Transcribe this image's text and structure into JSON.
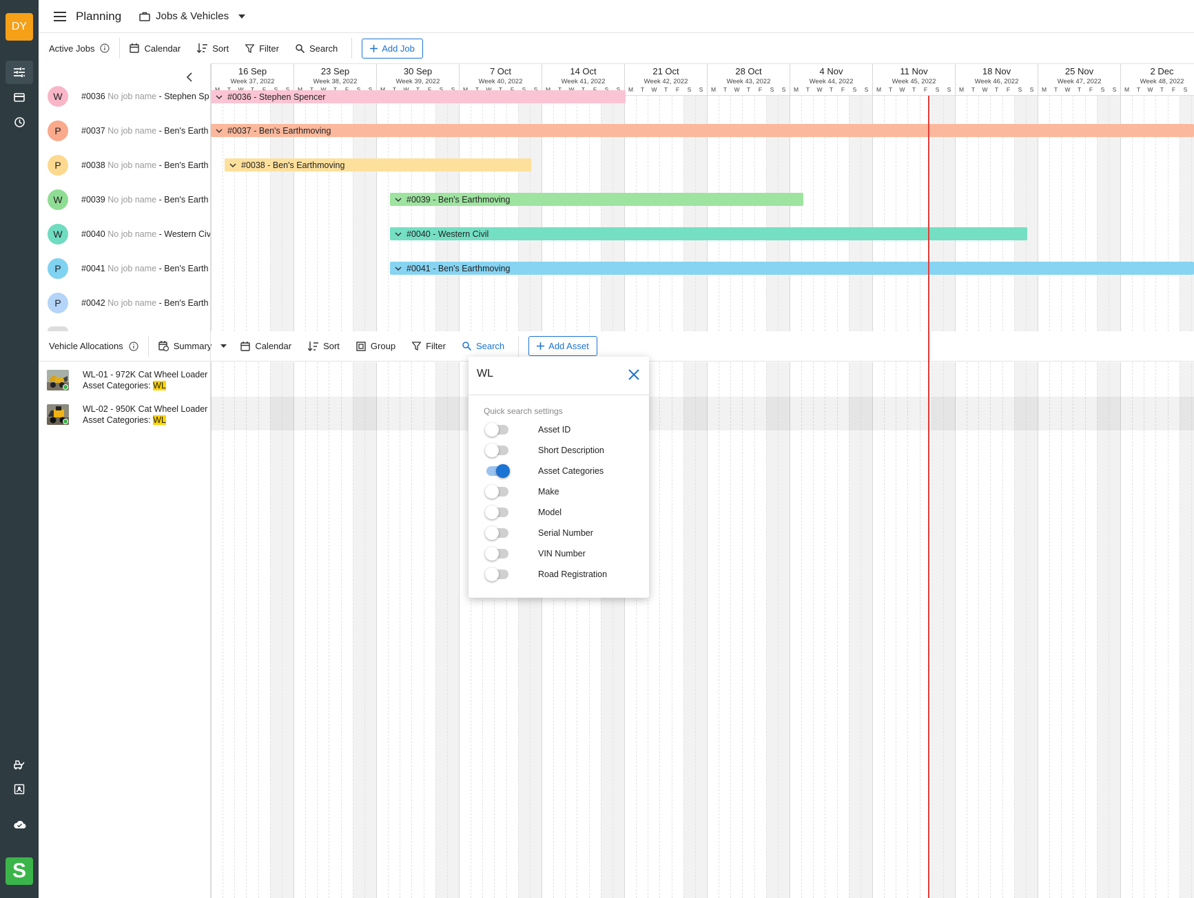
{
  "app": {
    "avatar_initials": "DY",
    "title": "Planning",
    "view_selector": "Jobs & Vehicles",
    "brand_letter": "S"
  },
  "jobs_toolbar": {
    "label": "Active Jobs",
    "calendar": "Calendar",
    "sort": "Sort",
    "filter": "Filter",
    "search": "Search",
    "add": "Add Job"
  },
  "timeline": {
    "weeks": [
      {
        "date": "16 Sep",
        "week": "Week 37, 2022"
      },
      {
        "date": "23 Sep",
        "week": "Week 38, 2022"
      },
      {
        "date": "30 Sep",
        "week": "Week 39, 2022"
      },
      {
        "date": "7 Oct",
        "week": "Week 40, 2022"
      },
      {
        "date": "14 Oct",
        "week": "Week 41, 2022"
      },
      {
        "date": "21 Oct",
        "week": "Week 42, 2022"
      },
      {
        "date": "28 Oct",
        "week": "Week 43, 2022"
      },
      {
        "date": "4 Nov",
        "week": "Week 44, 2022"
      },
      {
        "date": "11 Nov",
        "week": "Week 45, 2022"
      },
      {
        "date": "18 Nov",
        "week": "Week 46, 2022"
      },
      {
        "date": "25 Nov",
        "week": "Week 47, 2022"
      },
      {
        "date": "2 Dec",
        "week": "Week 48, 2022"
      }
    ],
    "day_letters": [
      "M",
      "T",
      "W",
      "T",
      "F",
      "S",
      "S"
    ]
  },
  "jobs": [
    {
      "initial": "W",
      "color": "#f8b6c8",
      "number": "#0036",
      "no_name": "No job name",
      "client": "- Stephen Sp",
      "bar": "#0036 - Stephen Spencer",
      "bar_color": "#fbc4d4"
    },
    {
      "initial": "P",
      "color": "#f9a98c",
      "number": "#0037",
      "no_name": "No job name",
      "client": "- Ben's Earth",
      "bar": "#0037 - Ben's Earthmoving",
      "bar_color": "#fbb89c"
    },
    {
      "initial": "P",
      "color": "#fcd98e",
      "number": "#0038",
      "no_name": "No job name",
      "client": "- Ben's Earth",
      "bar": "#0038 - Ben's Earthmoving",
      "bar_color": "#fde09c"
    },
    {
      "initial": "W",
      "color": "#8fdd94",
      "number": "#0039",
      "no_name": "No job name",
      "client": "- Ben's Earth",
      "bar": "#0039 - Ben's Earthmoving",
      "bar_color": "#9ee3a0"
    },
    {
      "initial": "W",
      "color": "#6fdcc1",
      "number": "#0040",
      "no_name": "No job name",
      "client": "- Western Civ",
      "bar": "#0040 - Western Civil",
      "bar_color": "#74dfc3"
    },
    {
      "initial": "P",
      "color": "#80d2f1",
      "number": "#0041",
      "no_name": "No job name",
      "client": "- Ben's Earth",
      "bar": "#0041 - Ben's Earthmoving",
      "bar_color": "#86d4f2"
    },
    {
      "initial": "P",
      "color": "#b4d4f8",
      "number": "#0042",
      "no_name": "No job name",
      "client": "- Ben's Earth",
      "bar": "",
      "bar_color": ""
    }
  ],
  "vehicles_toolbar": {
    "label": "Vehicle Allocations",
    "summary": "Summary",
    "calendar": "Calendar",
    "sort": "Sort",
    "group": "Group",
    "filter": "Filter",
    "search": "Search",
    "add": "Add Asset"
  },
  "vehicles": [
    {
      "title": "WL-01  - 972K Cat Wheel Loader",
      "cat_label": "Asset Categories:",
      "cat_value": "WL"
    },
    {
      "title": "WL-02  - 950K Cat Wheel Loader",
      "cat_label": "Asset Categories:",
      "cat_value": "WL"
    }
  ],
  "search_popup": {
    "query": "WL",
    "heading": "Quick search settings",
    "options": [
      {
        "label": "Asset ID",
        "on": false
      },
      {
        "label": "Short Description",
        "on": false
      },
      {
        "label": "Asset Categories",
        "on": true
      },
      {
        "label": "Make",
        "on": false
      },
      {
        "label": "Model",
        "on": false
      },
      {
        "label": "Serial Number",
        "on": false
      },
      {
        "label": "VIN Number",
        "on": false
      },
      {
        "label": "Road Registration",
        "on": false
      }
    ]
  },
  "colors": {
    "accent": "#1b73d3",
    "rail": "#2e3b40",
    "today_line": "#e53935",
    "highlight": "#ffd400"
  }
}
